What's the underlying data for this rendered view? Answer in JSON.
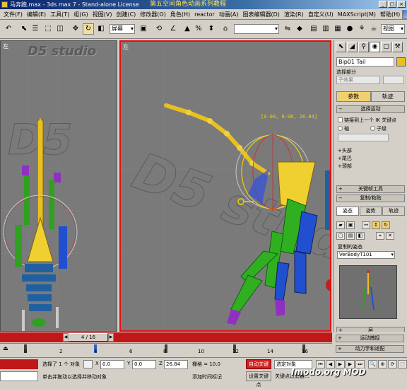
{
  "window": {
    "title": "马奔跑.max - 3ds max 7 - Stand-alone License",
    "overlay_title": "第五空间角色动画系列教程",
    "buttons": [
      "_",
      "□",
      "×"
    ]
  },
  "menu": [
    "文件(F)",
    "编辑(E)",
    "工具(T)",
    "组(G)",
    "视图(V)",
    "创建(C)",
    "修改器(O)",
    "角色(H)",
    "reactor",
    "动画(A)",
    "图表编辑器(D)",
    "渲染(R)",
    "自定义(U)",
    "MAXScript(M)",
    "帮助(H)"
  ],
  "toolbar": {
    "coord_system": "屏幕",
    "selection_set_value": "",
    "view_label": "视图"
  },
  "viewports": {
    "left": {
      "label": "左",
      "watermark": "D5 studio"
    },
    "perspective": {
      "label": "左",
      "coord_readout": "[0.00, 0.00, 26.84]"
    }
  },
  "command_panel": {
    "object_name": "Bip01 Tail",
    "object_color": "#e8c020",
    "selection_set_label": "选择部分",
    "selection_set_value": "子效果",
    "mode_tabs": [
      "参数",
      "轨迹"
    ],
    "rollout_track_selection": "选择运动",
    "link_option": "链接到上一个 IK 关键点",
    "radio_a": "轴",
    "radio_b": "子级",
    "key_list": [
      "+头部",
      "+尾巴",
      "+颈部"
    ],
    "rollout_key_tools": "关键帧工具",
    "rollout_copy_paste": "复制/粘贴",
    "copy_tabs": [
      "姿态",
      "姿势",
      "轨迹"
    ],
    "copied_postures_label": "复制的姿态",
    "copied_posture_value": "VerBodyT101",
    "rollout_layers": "层",
    "rollout_motion_capture": "运动捕捉",
    "rollout_dynamics": "动力学和适配"
  },
  "timeline": {
    "frame_display": "4 / 16",
    "ruler_ticks": [
      "0",
      "2",
      "4",
      "6",
      "8",
      "10",
      "12",
      "14",
      "16"
    ],
    "current_frame": 4,
    "total_frames": 16
  },
  "status": {
    "selected_count": "选择了 1 个 对象",
    "x_label": "X",
    "x_value": "0.0",
    "y_label": "Y",
    "y_value": "0.0",
    "z_label": "Z",
    "z_value": "26.84",
    "grid": "栅格 = 10.0",
    "prompt": "单击并拖动以选择并移动对象",
    "add_time_tag": "添加时间标记",
    "auto_key": "自动关键点",
    "set_key": "设置关键点",
    "key_filter_mode": "选定对象",
    "key_filters": "关键点过滤器...",
    "watermark": "Imodo.org MOD"
  },
  "colors": {
    "active_viewport_border": "#e01010",
    "timebar": "#c01818",
    "selection_yellow": "#f0d000",
    "bone_green": "#30b020",
    "bone_blue": "#2050d0"
  }
}
